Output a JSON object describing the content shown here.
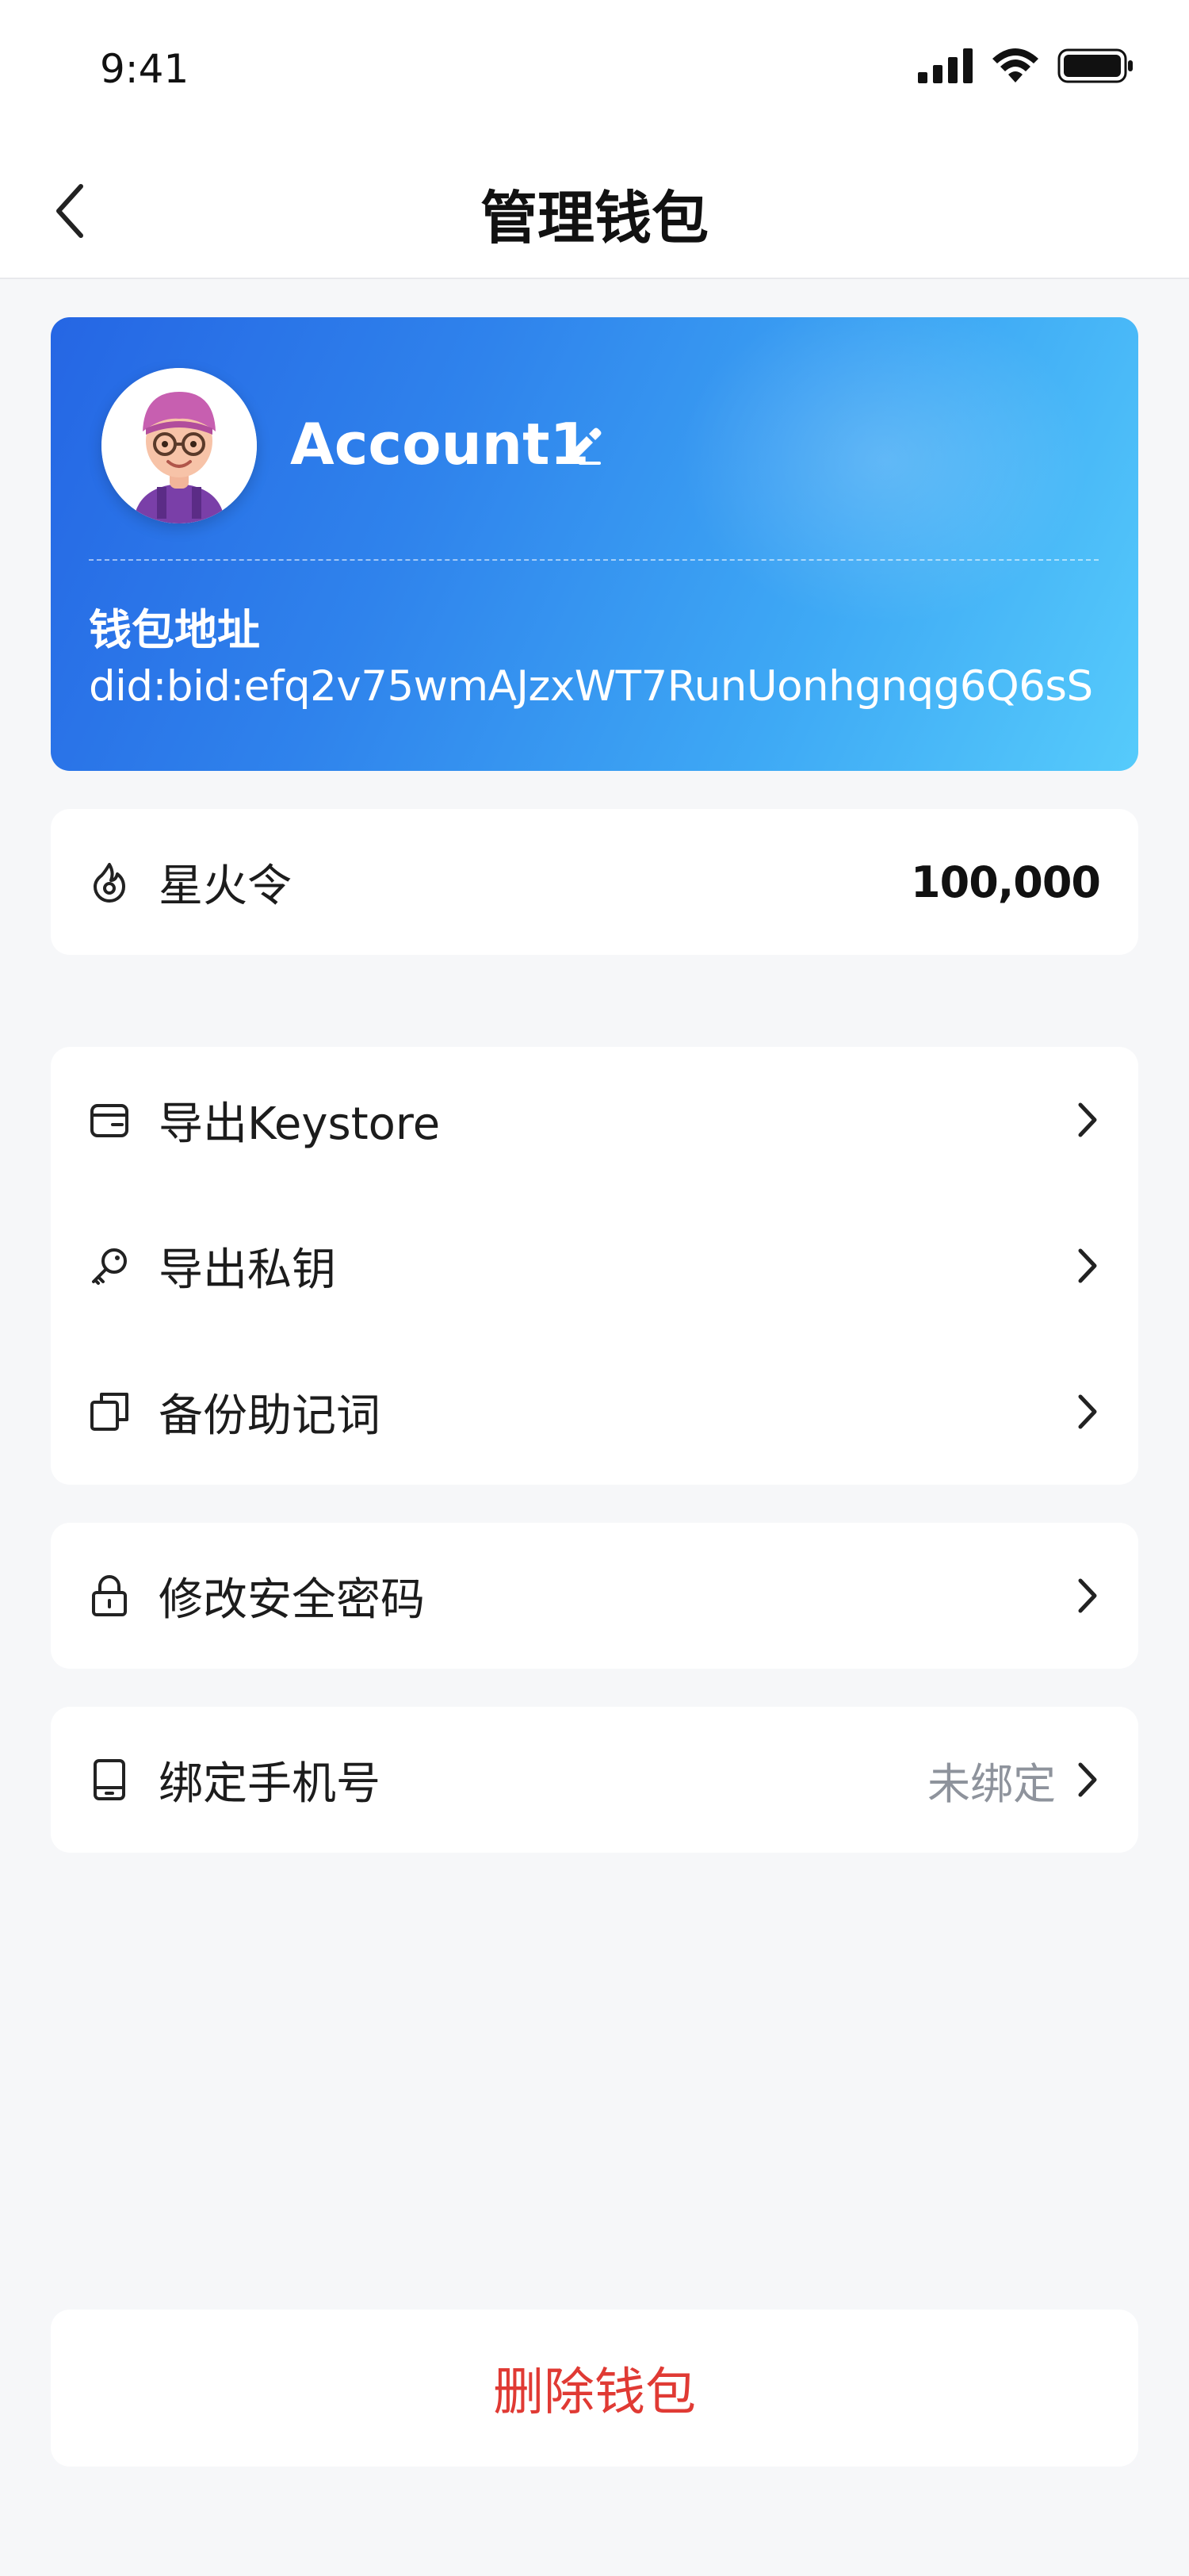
{
  "status_bar": {
    "time": "9:41"
  },
  "nav": {
    "title": "管理钱包"
  },
  "account": {
    "name": "Account1",
    "address_label": "钱包地址",
    "address": "did:bid:efq2v75wmAJzxWT7RunUonhgnqg6Q6sS"
  },
  "token": {
    "name": "星火令",
    "amount": "100,000"
  },
  "menu": {
    "export_keystore": "导出Keystore",
    "export_private_key": "导出私钥",
    "backup_mnemonic": "备份助记词",
    "change_password": "修改安全密码",
    "bind_phone": "绑定手机号",
    "bind_phone_status": "未绑定"
  },
  "delete_wallet": "删除钱包",
  "colors": {
    "card_gradient_start": "#2566e4",
    "card_gradient_end": "#56cbfb",
    "danger": "#e03a34",
    "muted": "#8e939c",
    "background": "#f6f7f9"
  },
  "icons": {
    "token": "flame-circle-icon",
    "keystore": "wallet-icon",
    "private_key": "key-icon",
    "mnemonic": "copy-icon",
    "password": "lock-icon",
    "phone": "phone-icon",
    "chevron": "chevron-right-icon",
    "back": "chevron-left-icon",
    "edit": "pencil-icon"
  }
}
